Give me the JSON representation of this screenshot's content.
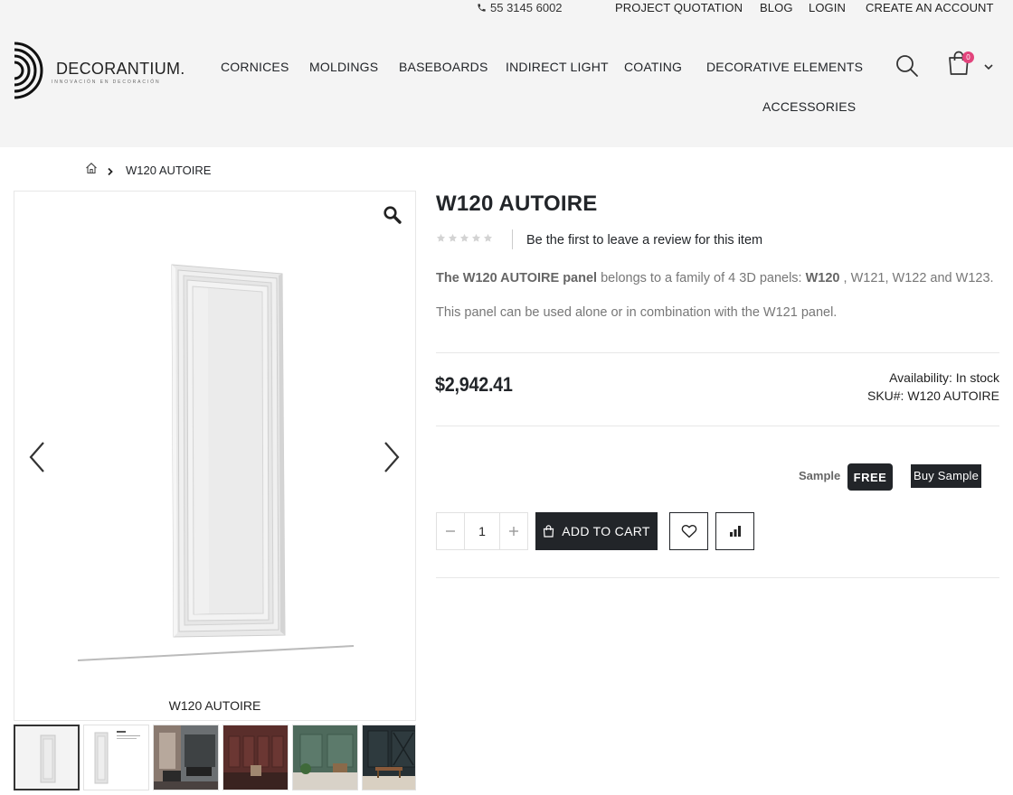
{
  "topbar": {
    "phone": "55 3145 6002",
    "links": [
      "PROJECT QUOTATION",
      "BLOG",
      "LOGIN",
      "CREATE AN ACCOUNT"
    ]
  },
  "header": {
    "logo_text": "DECORANTIUM.",
    "logo_tagline": "INNOVACIÓN EN DECORACIÓN",
    "nav": [
      "CORNICES",
      "MOLDINGS",
      "BASEBOARDS",
      "INDIRECT LIGHT",
      "COATING",
      "DECORATIVE ELEMENTS",
      "ACCESSORIES"
    ],
    "cart_count": "0"
  },
  "breadcrumb": {
    "current": "W120 AUTOIRE"
  },
  "gallery": {
    "caption": "W120 AUTOIRE",
    "thumb_count": 6
  },
  "product": {
    "title": "W120 AUTOIRE",
    "rating_stars": 0,
    "review_link": "Be the first to leave a review for this item",
    "desc1_strong": "The W120 AUTOIRE panel",
    "desc1_mid": " belongs to a family of 4 3D panels: ",
    "desc1_strong2": "W120",
    "desc1_end": " , W121, W122 and W123.",
    "desc2": "This panel can be used alone or in combination with the W121 panel.",
    "price": "$2,942.41",
    "availability": "Availability: In stock",
    "sku": "SKU#:  W120 AUTOIRE",
    "sample_label": "Sample",
    "free_badge": "FREE",
    "buy_sample": "Buy Sample",
    "quantity": "1",
    "add_to_cart": "ADD TO CART"
  },
  "colors": {
    "dark": "#222529",
    "badge": "#e2447c",
    "header_bg": "#f4f4f4"
  },
  "icons": [
    "phone-icon",
    "search-icon",
    "cart-icon",
    "chevron-down-icon",
    "home-icon",
    "chevron-right-icon",
    "zoom-icon",
    "arrow-left-icon",
    "arrow-right-icon",
    "star-icon",
    "shopping-bag-icon",
    "heart-icon",
    "compare-icon"
  ]
}
